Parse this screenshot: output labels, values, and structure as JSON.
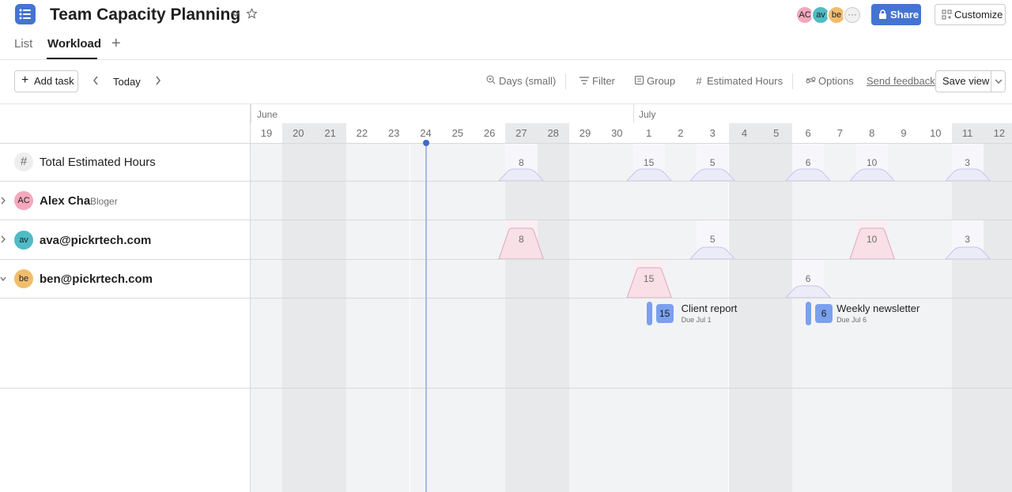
{
  "header": {
    "title": "Team Capacity Planning",
    "tabs": [
      {
        "label": "List"
      },
      {
        "label": "Workload"
      }
    ],
    "active_tab": "Workload",
    "members": [
      {
        "initials": "AC",
        "color": "#f4a8be"
      },
      {
        "initials": "av",
        "color": "#4fbcc5"
      },
      {
        "initials": "be",
        "color": "#f1bd6c"
      }
    ],
    "more_members": "···",
    "share_label": "Share",
    "customize_label": "Customize"
  },
  "toolbar": {
    "add_task_label": "Add task",
    "today_label": "Today",
    "zoom_label": "Days (small)",
    "filter_label": "Filter",
    "group_label": "Group",
    "estimate_label": "Estimated Hours",
    "options_label": "Options",
    "feedback_label": "Send feedback",
    "save_view_label": "Save view"
  },
  "timeline": {
    "months": [
      {
        "label": "June"
      },
      {
        "label": "July"
      }
    ],
    "days": [
      {
        "label": "19",
        "weekend": false
      },
      {
        "label": "20",
        "weekend": true
      },
      {
        "label": "21",
        "weekend": true
      },
      {
        "label": "22",
        "weekend": false
      },
      {
        "label": "23",
        "weekend": false
      },
      {
        "label": "24",
        "weekend": false,
        "today": true
      },
      {
        "label": "25",
        "weekend": false
      },
      {
        "label": "26",
        "weekend": false
      },
      {
        "label": "27",
        "weekend": true
      },
      {
        "label": "28",
        "weekend": true
      },
      {
        "label": "29",
        "weekend": false
      },
      {
        "label": "30",
        "weekend": false
      },
      {
        "label": "1",
        "weekend": false
      },
      {
        "label": "2",
        "weekend": false
      },
      {
        "label": "3",
        "weekend": false
      },
      {
        "label": "4",
        "weekend": true
      },
      {
        "label": "5",
        "weekend": true
      },
      {
        "label": "6",
        "weekend": false
      },
      {
        "label": "7",
        "weekend": false
      },
      {
        "label": "8",
        "weekend": false
      },
      {
        "label": "9",
        "weekend": false
      },
      {
        "label": "10",
        "weekend": false
      },
      {
        "label": "11",
        "weekend": true
      },
      {
        "label": "12",
        "weekend": true
      }
    ]
  },
  "rows": {
    "total": {
      "label": "Total Estimated Hours",
      "hours": [
        {
          "day": "27",
          "value": "8"
        },
        {
          "day": "1",
          "value": "15"
        },
        {
          "day": "3",
          "value": "5"
        },
        {
          "day": "6",
          "value": "6"
        },
        {
          "day": "8",
          "value": "10"
        },
        {
          "day": "11",
          "value": "3"
        }
      ]
    },
    "alex": {
      "initials": "AC",
      "name": "Alex Cha",
      "role": "Bloger",
      "hours": []
    },
    "ava": {
      "initials": "av",
      "name": "ava@pickrtech.com",
      "hours": [
        {
          "day": "27",
          "value": "8",
          "over": true
        },
        {
          "day": "3",
          "value": "5"
        },
        {
          "day": "8",
          "value": "10",
          "over": true
        },
        {
          "day": "11",
          "value": "3"
        }
      ]
    },
    "ben": {
      "initials": "be",
      "name": "ben@pickrtech.com",
      "hours": [
        {
          "day": "1",
          "value": "15",
          "over": true
        },
        {
          "day": "6",
          "value": "6"
        }
      ]
    }
  },
  "tasks": [
    {
      "hours": "15",
      "name": "Client report",
      "due": "Due Jul 1",
      "day": "1"
    },
    {
      "hours": "6",
      "name": "Weekly newsletter",
      "due": "Due Jul 6",
      "day": "6"
    }
  ],
  "colors": {
    "accent": "#4573d2",
    "overload": "#f9d9e0",
    "normal": "#e5e2f7"
  }
}
